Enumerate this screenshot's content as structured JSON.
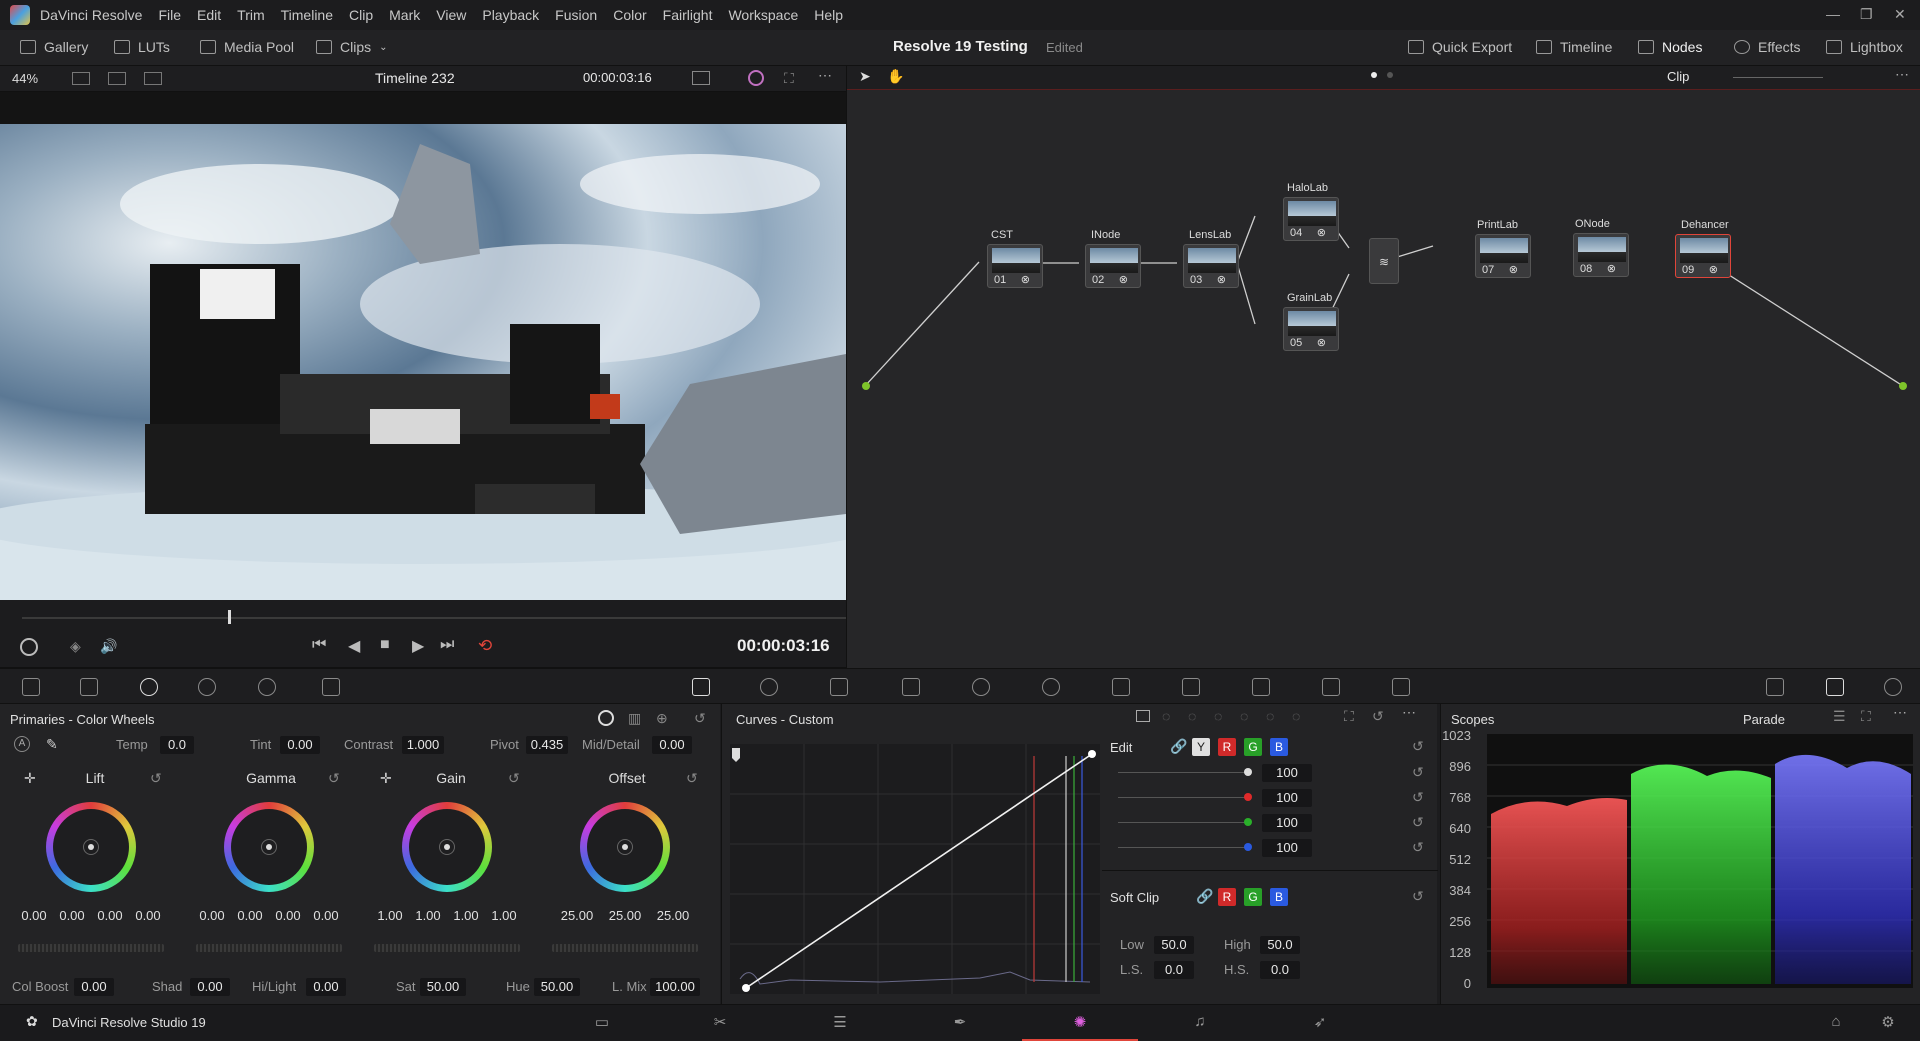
{
  "app": {
    "name": "DaVinci Resolve",
    "status_name": "DaVinci Resolve Studio 19"
  },
  "menu": [
    "File",
    "Edit",
    "Trim",
    "Timeline",
    "Clip",
    "Mark",
    "View",
    "Playback",
    "Fusion",
    "Color",
    "Fairlight",
    "Workspace",
    "Help"
  ],
  "toolbar": {
    "left": [
      "Gallery",
      "LUTs",
      "Media Pool",
      "Clips"
    ],
    "project_title": "Resolve 19 Testing",
    "project_status": "Edited",
    "right": [
      "Quick Export",
      "Timeline",
      "Nodes",
      "Effects",
      "Lightbox"
    ]
  },
  "viewer": {
    "zoom": "44%",
    "timeline": "Timeline 232",
    "timecode_top": "00:00:03:16",
    "timecode": "00:00:03:16"
  },
  "nodes": {
    "mode": "Clip",
    "items": [
      {
        "label": "CST",
        "num": "01"
      },
      {
        "label": "INode",
        "num": "02"
      },
      {
        "label": "LensLab",
        "num": "03"
      },
      {
        "label": "HaloLab",
        "num": "04"
      },
      {
        "label": "GrainLab",
        "num": "05"
      },
      {
        "label": "PrintLab",
        "num": "07"
      },
      {
        "label": "ONode",
        "num": "08"
      },
      {
        "label": "Dehancer",
        "num": "09"
      }
    ]
  },
  "primaries": {
    "title": "Primaries - Color Wheels",
    "temp_label": "Temp",
    "temp": "0.0",
    "tint_label": "Tint",
    "tint": "0.00",
    "contrast_label": "Contrast",
    "contrast": "1.000",
    "pivot_label": "Pivot",
    "pivot": "0.435",
    "middetail_label": "Mid/Detail",
    "middetail": "0.00",
    "wheels": [
      {
        "name": "Lift",
        "values": [
          "0.00",
          "0.00",
          "0.00",
          "0.00"
        ]
      },
      {
        "name": "Gamma",
        "values": [
          "0.00",
          "0.00",
          "0.00",
          "0.00"
        ]
      },
      {
        "name": "Gain",
        "values": [
          "1.00",
          "1.00",
          "1.00",
          "1.00"
        ]
      },
      {
        "name": "Offset",
        "values": [
          "25.00",
          "25.00",
          "25.00"
        ]
      }
    ],
    "colboost_label": "Col Boost",
    "colboost": "0.00",
    "shad_label": "Shad",
    "shad": "0.00",
    "hilight_label": "Hi/Light",
    "hilight": "0.00",
    "sat_label": "Sat",
    "sat": "50.00",
    "hue_label": "Hue",
    "hue": "50.00",
    "lmix_label": "L. Mix",
    "lmix": "100.00"
  },
  "curves": {
    "title": "Curves - Custom",
    "edit_label": "Edit",
    "channel_chips": [
      "Y",
      "R",
      "G",
      "B"
    ],
    "intensities": [
      "100",
      "100",
      "100",
      "100"
    ],
    "softclip_label": "Soft Clip",
    "low_label": "Low",
    "low": "50.0",
    "high_label": "High",
    "high": "50.0",
    "ls_label": "L.S.",
    "ls": "0.0",
    "hs_label": "H.S.",
    "hs": "0.0"
  },
  "scopes": {
    "title": "Scopes",
    "mode": "Parade",
    "scale": [
      "1023",
      "896",
      "768",
      "640",
      "512",
      "384",
      "256",
      "128",
      "0"
    ]
  },
  "colors": {
    "accent": "#e0453a",
    "node_green": "#7ec42a",
    "node_blue": "#2aa4e4",
    "red": "#e02a2a",
    "green": "#2ab02a",
    "blue": "#2a5ae0"
  }
}
